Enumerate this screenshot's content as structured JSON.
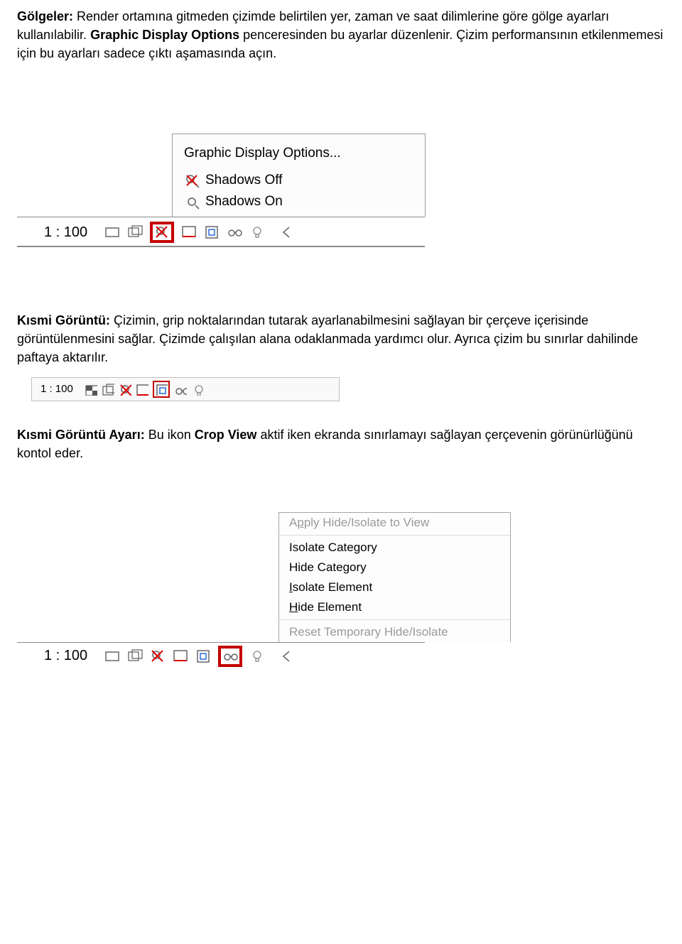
{
  "para1": {
    "lead": "Gölgeler:",
    "t1": "  Render ortamına gitmeden çizimde belirtilen yer, zaman ve saat dilimlerine göre gölge ayarları kullanılabilir. ",
    "bold2": "Graphic Display Options",
    "t2": " penceresinden bu ayarlar düzenlenir. Çizim performansının etkilenmemesi için bu ayarları sadece çıktı aşamasında açın."
  },
  "popup1": {
    "title": "Graphic Display Options...",
    "off": "Shadows Off",
    "on": "Shadows On"
  },
  "scale100": "1 : 100",
  "para2": {
    "lead": "Kısmi Görüntü:",
    "body": " Çizimin, grip noktalarından tutarak ayarlanabilmesini sağlayan bir çerçeve içerisinde görüntülenmesini sağlar. Çizimde çalışılan alana odaklanmada yardımcı olur. Ayrıca çizim bu sınırlar dahilinde paftaya aktarılır."
  },
  "para3": {
    "lead": "Kısmi Görüntü Ayarı:",
    "t1": " Bu ikon ",
    "bold2": "Crop View",
    "t2": " aktif iken ekranda sınırlamayı sağlayan çerçevenin görünürlüğünü kontol eder."
  },
  "popup3": {
    "apply_pre": "A",
    "apply_ul": "p",
    "apply_post": "ply Hide/Isolate to View",
    "isoCat": "Isolate Category",
    "hideCat": "Hide Category",
    "isoEl_ul": "I",
    "isoEl_post": "solate Element",
    "hideEl_ul": "H",
    "hideEl_post": "ide Element",
    "reset": "Reset Temporary Hide/Isolate"
  }
}
